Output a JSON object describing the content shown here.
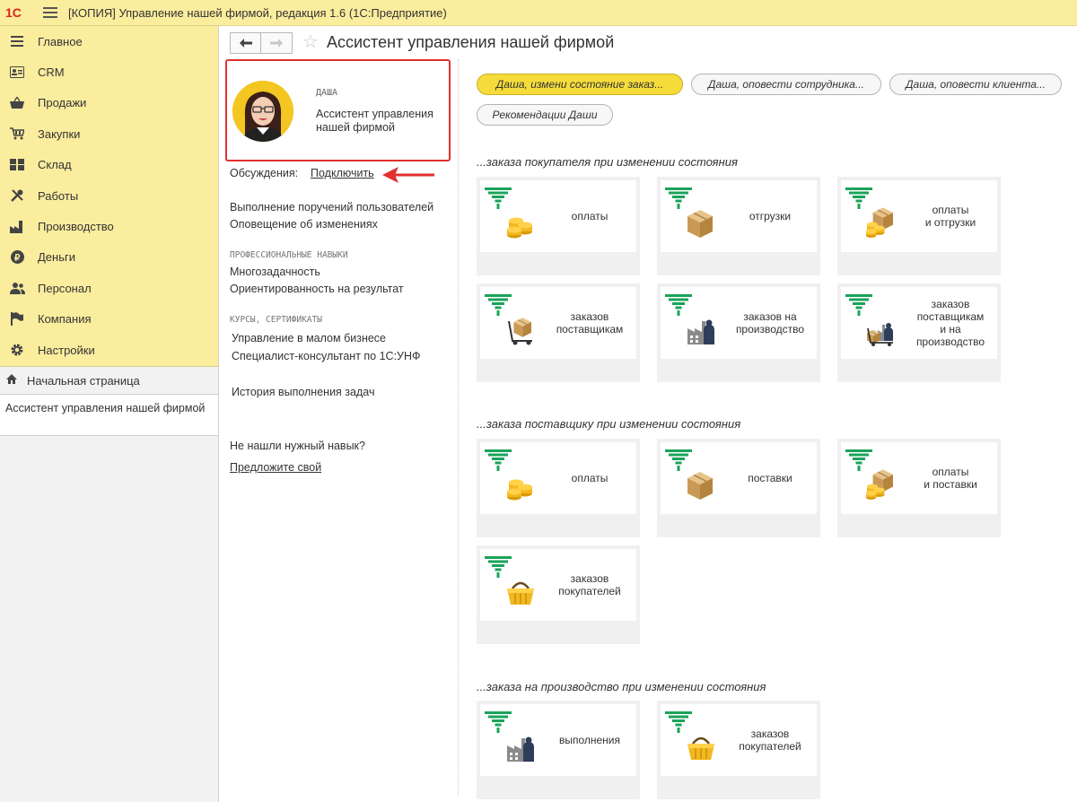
{
  "window": {
    "logo_text": "1С",
    "title": "[КОПИЯ] Управление нашей фирмой, редакция 1.6  (1С:Предприятие)"
  },
  "sidebar": {
    "sections": [
      {
        "label": "Главное",
        "icon": "menu-lines-icon"
      },
      {
        "label": "CRM",
        "icon": "contacts-card-icon"
      },
      {
        "label": "Продажи",
        "icon": "shopping-basket-icon"
      },
      {
        "label": "Закупки",
        "icon": "cart-icon"
      },
      {
        "label": "Склад",
        "icon": "warehouse-grid-icon"
      },
      {
        "label": "Работы",
        "icon": "tools-icon"
      },
      {
        "label": "Производство",
        "icon": "factory-icon"
      },
      {
        "label": "Деньги",
        "icon": "ruble-coin-icon"
      },
      {
        "label": "Персонал",
        "icon": "people-icon"
      },
      {
        "label": "Компания",
        "icon": "flag-icon"
      },
      {
        "label": "Настройки",
        "icon": "gear-icon"
      }
    ],
    "home_label": "Начальная страница",
    "open_window": "Ассистент управления нашей фирмой"
  },
  "header": {
    "title": "Ассистент управления нашей фирмой"
  },
  "profile": {
    "name": "ДАША",
    "role": "Ассистент управления нашей фирмой"
  },
  "discussions": {
    "label": "Обсуждения:",
    "link": "Подключить"
  },
  "info": {
    "duties": [
      "Выполнение поручений пользователей",
      "Оповещение об изменениях"
    ],
    "skills_caption": "ПРОФЕССИОНАЛЬНЫЕ НАВЫКИ",
    "skills": [
      "Многозадачность",
      "Ориентированность на результат"
    ],
    "courses_caption": "КУРСЫ, СЕРТИФИКАТЫ",
    "courses": [
      "Управление в малом бизнесе",
      "Специалист-консультант по 1С:УНФ"
    ],
    "history": "История выполнения задач",
    "not_found": "Не нашли нужный навык?",
    "suggest": "Предложите свой"
  },
  "commands": [
    "Даша, измени состояние заказ...",
    "Даша, оповести сотрудника...",
    "Даша, оповести клиента...",
    "Рекомендации Даши"
  ],
  "groups": [
    {
      "title": "...заказа покупателя при изменении состояния",
      "tiles": [
        {
          "label": "оплаты",
          "pic": "coins"
        },
        {
          "label": "отгрузки",
          "pic": "box"
        },
        {
          "label": "оплаты\nи отгрузки",
          "pic": "coins-box"
        },
        {
          "label": "заказов\nпоставщикам",
          "pic": "cart-boxes"
        },
        {
          "label": "заказов на\nпроизводство",
          "pic": "factory"
        },
        {
          "label": "заказов\nпоставщикам\nи на\nпроизводство",
          "pic": "cart-factory"
        }
      ]
    },
    {
      "title": "...заказа поставщику при изменении состояния",
      "tiles": [
        {
          "label": "оплаты",
          "pic": "coins"
        },
        {
          "label": "поставки",
          "pic": "box"
        },
        {
          "label": "оплаты\nи поставки",
          "pic": "coins-box"
        },
        {
          "label": "заказов\nпокупателей",
          "pic": "basket"
        }
      ]
    },
    {
      "title": "...заказа на производство при изменении состояния",
      "tiles": [
        {
          "label": "выполнения",
          "pic": "factory"
        },
        {
          "label": "заказов\nпокупателей",
          "pic": "basket"
        }
      ]
    }
  ],
  "colors": {
    "sidebar_bg": "#fbed9e",
    "primary_pill": "#f5dc3b",
    "highlight_border": "#e03030",
    "funnel_green": "#1aa35a"
  }
}
